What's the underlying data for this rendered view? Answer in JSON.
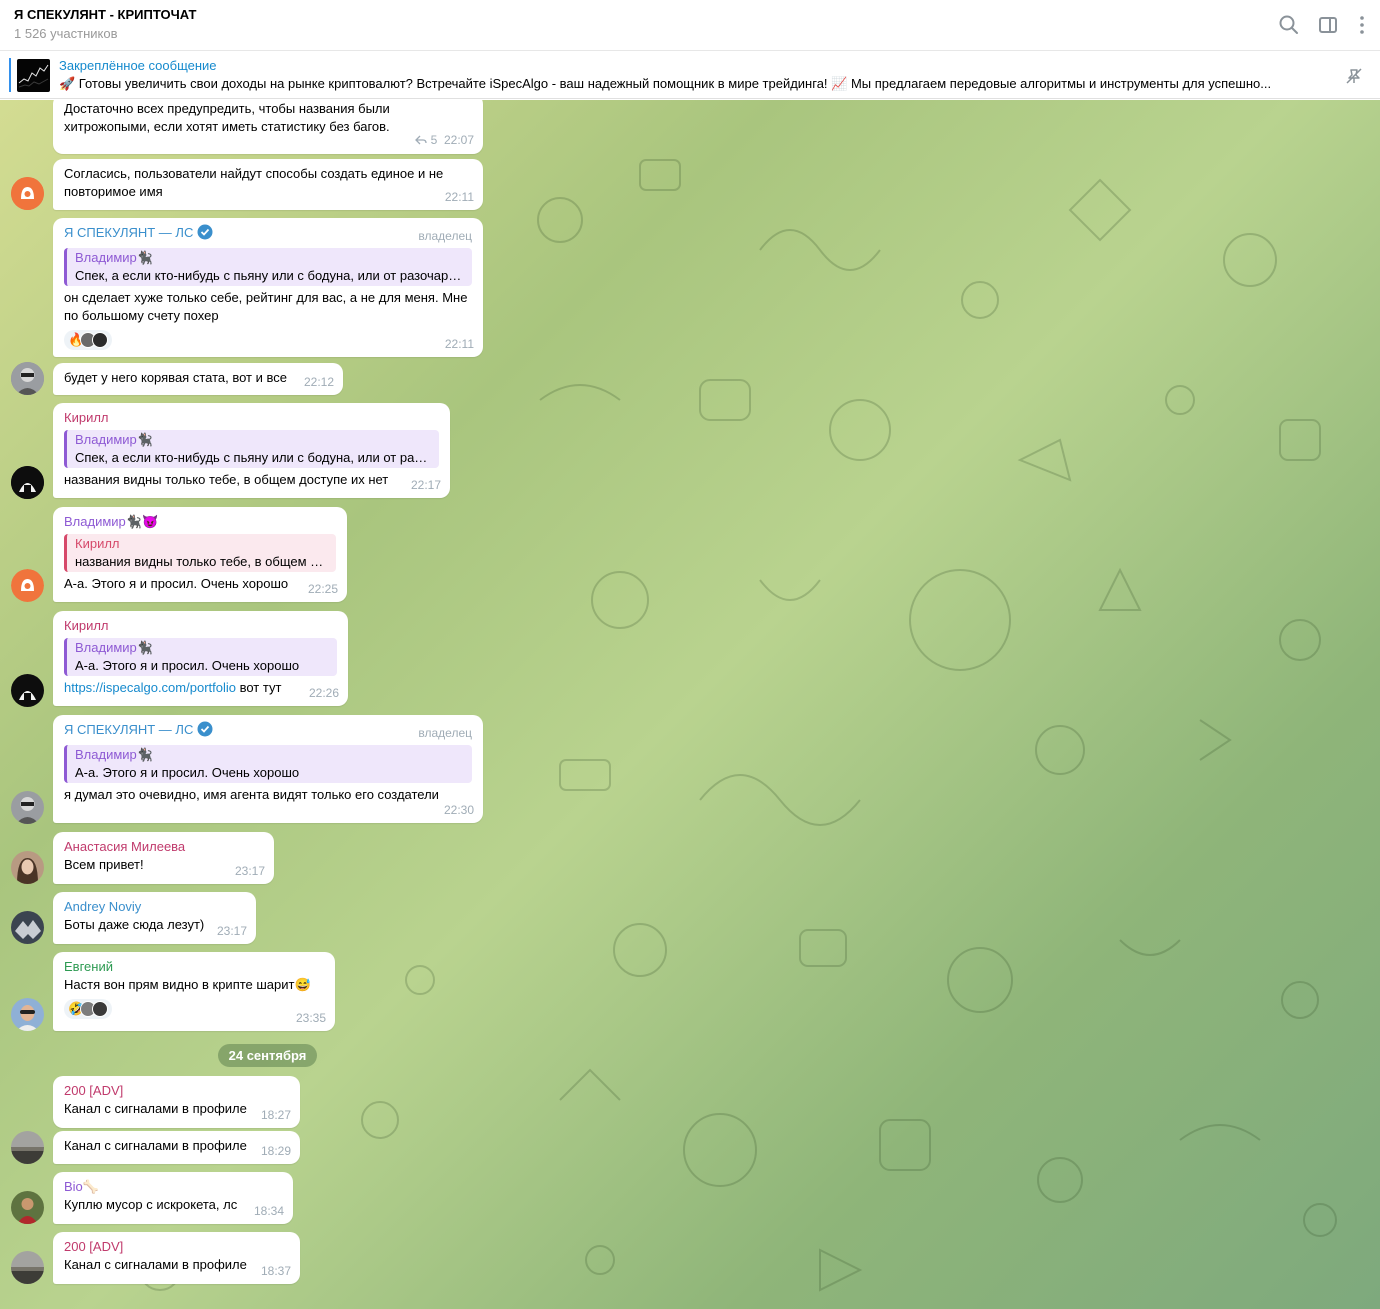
{
  "header": {
    "title": "Я СПЕКУЛЯНТ - КРИПТОЧАТ",
    "subtitle": "1 526 участников",
    "icons": [
      "search-icon",
      "sidebar-toggle-icon",
      "more-vertical-icon"
    ]
  },
  "pinned": {
    "label": "Закреплённое сообщение",
    "text": "🚀 Готовы увеличить свои доходы на рынке криптовалют? Встречайте iSpecAlgo - ваш надежный помощник в мире трейдинга! 📈 Мы предлагаем передовые алгоритмы и инструменты для успешно..."
  },
  "date_divider": "24 сентября",
  "messages": [
    {
      "text": "Достаточно всех предупредить, чтобы названия были\nхитрожопыми, если хотят иметь статистику без багов.",
      "replies": "5",
      "time": "22:07"
    },
    {
      "text": "Согласись, пользователи найдут способы создать единое и не\nповторимое имя",
      "time": "22:11"
    },
    {
      "sender": "Я СПЕКУЛЯНТ — ЛС",
      "badge": "владелец",
      "quote_name": "Владимир🐈‍⬛",
      "quote_text": "Спек, а если кто-нибудь с пьяну или с бодуна, или от разочарования",
      "text": "он сделает хуже только себе, рейтинг для вас, а не для меня. Мне\nпо большому счету похер",
      "reaction": "🔥",
      "time": "22:11"
    },
    {
      "text": "будет у него корявая стата, вот и все",
      "time": "22:12"
    },
    {
      "sender": "Кирилл",
      "quote_name": "Владимир🐈‍⬛",
      "quote_text": "Спек, а если кто-нибудь с пьяну или с бодуна, или от разочарования",
      "text": "названия видны только тебе, в общем доступе их нет",
      "time": "22:17"
    },
    {
      "sender": "Владимир🐈‍⬛😈",
      "quote_name": "Кирилл",
      "quote_text": "названия видны только тебе, в общем доступе их нет",
      "text": "А-а. Этого я и просил. Очень хорошо",
      "time": "22:25"
    },
    {
      "sender": "Кирилл",
      "quote_name": "Владимир🐈‍⬛",
      "quote_text": "А-а. Этого я и просил. Очень хорошо",
      "link": "https://ispecalgo.com/portfolio",
      "text_after": " вот тут",
      "time": "22:26"
    },
    {
      "sender": "Я СПЕКУЛЯНТ — ЛС",
      "badge": "владелец",
      "quote_name": "Владимир🐈‍⬛",
      "quote_text": "А-а. Этого я и просил. Очень хорошо",
      "text": "я думал это очевидно, имя агента видят только его создатели",
      "time": "22:30"
    },
    {
      "sender": "Анастасия Милеева",
      "text": "Всем привет!",
      "time": "23:17"
    },
    {
      "sender": "Andrey Noviy",
      "text": "Боты даже сюда лезут)",
      "time": "23:17"
    },
    {
      "sender": "Евгений",
      "text": "Настя вон прям видно в крипте шарит😅",
      "reaction": "🤣",
      "time": "23:35"
    },
    {
      "sender": "200 [ADV]",
      "text": "Канал с сигналами в профиле",
      "time": "18:27"
    },
    {
      "text": "Канал с сигналами в профиле",
      "time": "18:29"
    },
    {
      "sender": "Bio🦴",
      "text": "Куплю мусор с искрокета, лс",
      "time": "18:34"
    },
    {
      "sender": "200 [ADV]",
      "text": "Канал с сигналами в профиле",
      "time": "18:37"
    }
  ],
  "colors": {
    "accent": "#168acd",
    "owner_name": "#3a8fcc",
    "kirill": "#c03a6c",
    "vladimir": "#8e5ad4",
    "anastasia": "#c03a6c",
    "andrey": "#3a8fcc",
    "evgeny": "#2d9a52",
    "adv": "#c03a6c",
    "bio": "#8e5ad4"
  }
}
